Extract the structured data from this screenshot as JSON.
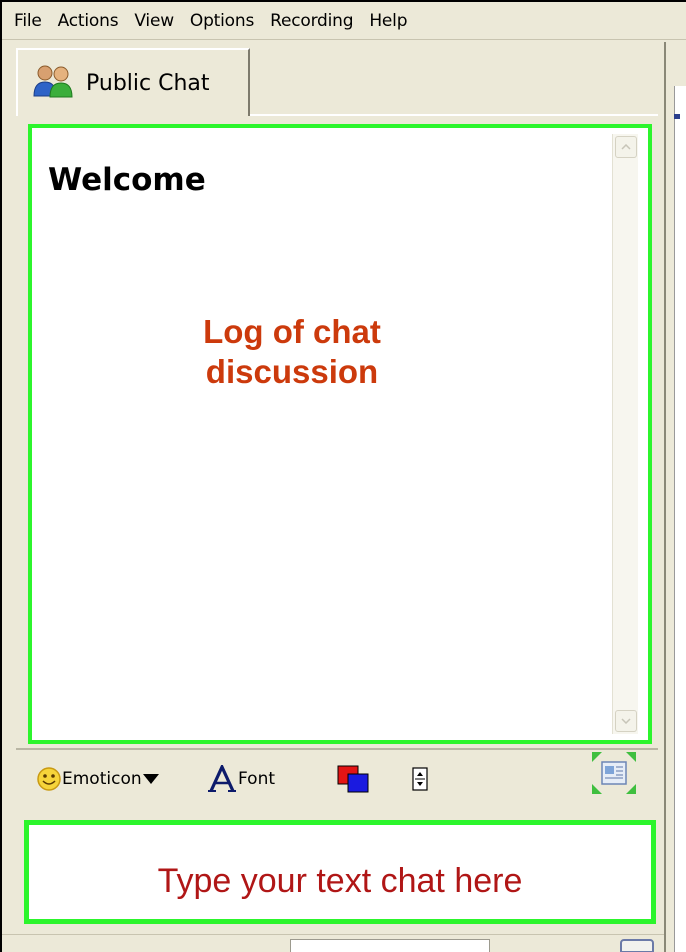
{
  "menu": {
    "items": [
      "File",
      "Actions",
      "View",
      "Options",
      "Recording",
      "Help"
    ]
  },
  "tab": {
    "label": "Public Chat",
    "icon": "users-icon"
  },
  "chat_log": {
    "welcome": "Welcome",
    "annotation_line1": "Log of chat",
    "annotation_line2": "discussion"
  },
  "toolbar": {
    "emoticon_label": "Emoticon",
    "font_label": "Font",
    "icons": [
      "smiley-icon",
      "dropdown-arrow-icon",
      "font-icon",
      "color-picker-icon",
      "spinner-icon",
      "expand-icon"
    ]
  },
  "chat_input": {
    "annotation": "Type your text chat here"
  },
  "colors": {
    "highlight_border": "#2cf52c",
    "annotation_log": "#cc3a0c",
    "annotation_input": "#b01616",
    "window_bg": "#ece9d8"
  }
}
